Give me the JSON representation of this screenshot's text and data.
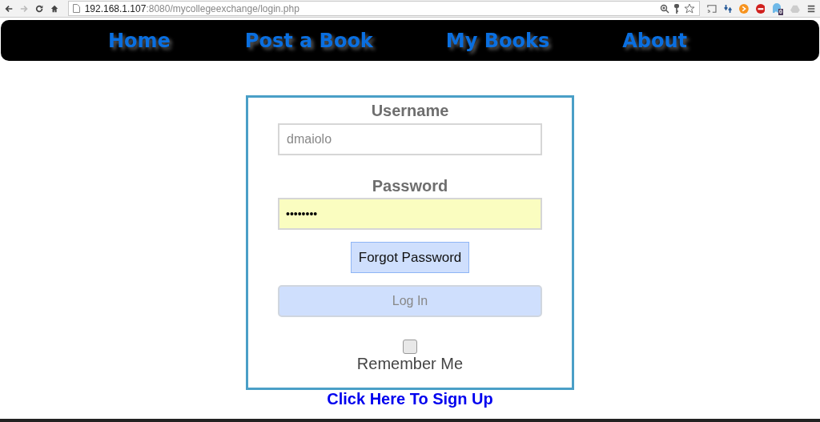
{
  "browser": {
    "url_host": "192.168.1.107",
    "url_path": ":8080/mycollegeexchange/login.php",
    "extension_badge": "0"
  },
  "nav": [
    {
      "label": "Home"
    },
    {
      "label": "Post a Book"
    },
    {
      "label": "My Books"
    },
    {
      "label": "About"
    }
  ],
  "form": {
    "username_label": "Username",
    "username_value": "dmaiolo",
    "password_label": "Password",
    "password_value": "••••••••",
    "forgot_button": "Forgot Password",
    "login_button": "Log In",
    "remember": {
      "label": "Remember Me",
      "checked": false
    }
  },
  "signup_link": "Click Here To Sign Up"
}
